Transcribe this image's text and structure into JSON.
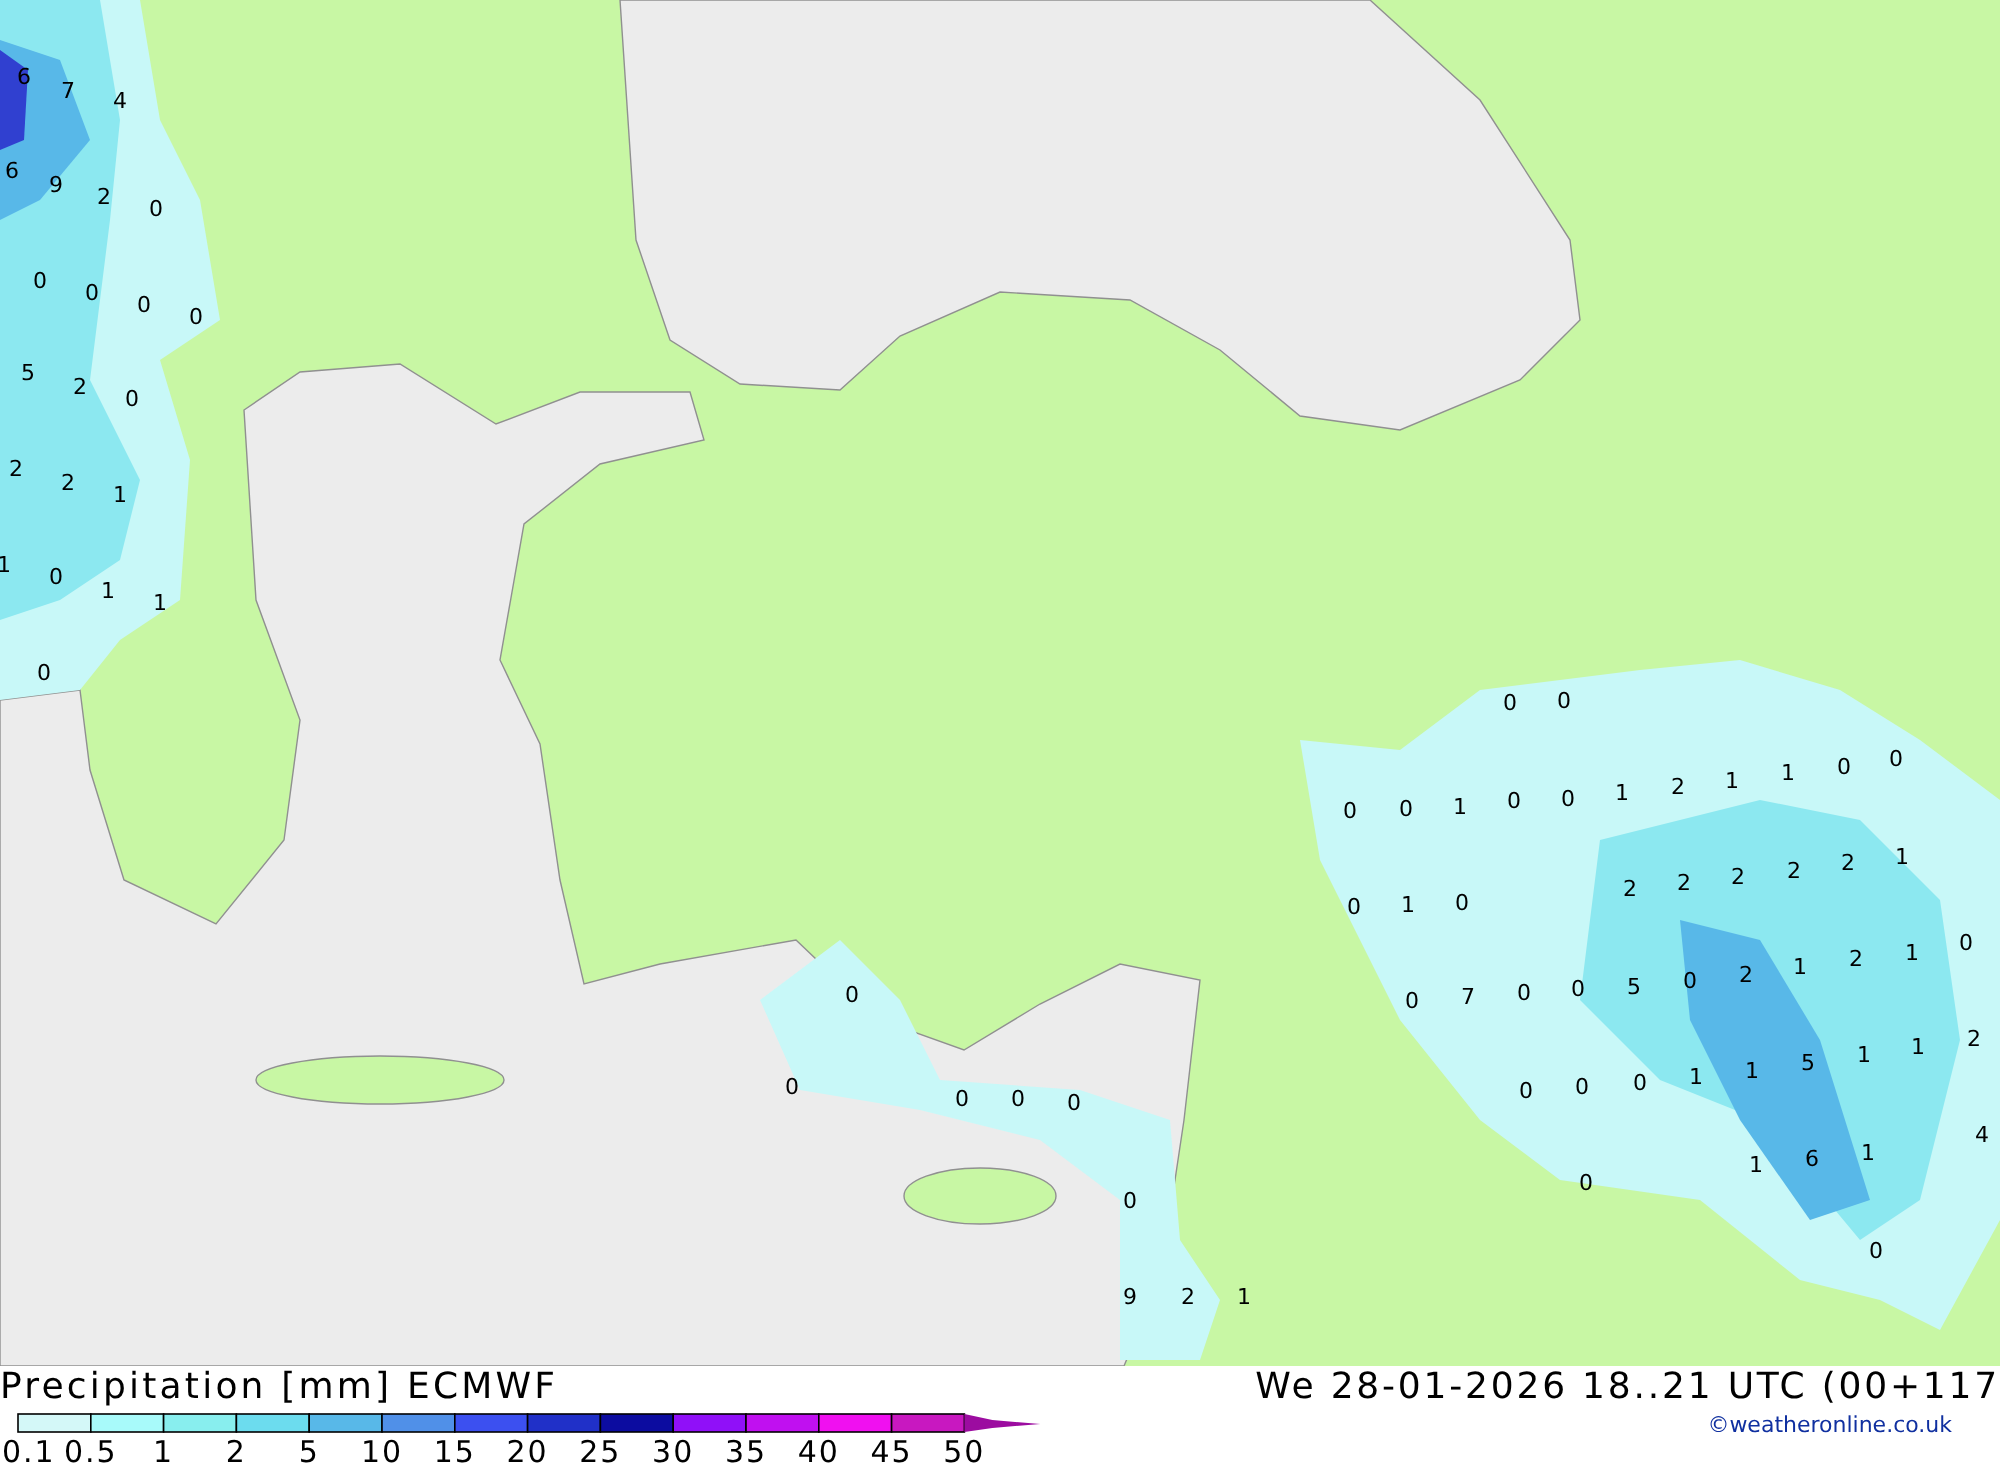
{
  "map": {
    "labels": [
      "6",
      "7",
      "4",
      "6",
      "9",
      "2",
      "0",
      "0",
      "0",
      "0",
      "0",
      "5",
      "2",
      "0",
      "2",
      "2",
      "1",
      "1",
      "0",
      "1",
      "1",
      "0",
      "0",
      "0",
      "0",
      "0",
      "1",
      "0",
      "0",
      "1",
      "2",
      "1",
      "1",
      "0",
      "0",
      "0",
      "1",
      "0",
      "2",
      "2",
      "2",
      "2",
      "2",
      "1",
      "0",
      "0",
      "7",
      "0",
      "0",
      "5",
      "0",
      "2",
      "1",
      "2",
      "1",
      "0",
      "0",
      "0",
      "0",
      "0",
      "0",
      "0",
      "0",
      "1",
      "1",
      "5",
      "1",
      "1",
      "2",
      "4",
      "1",
      "6",
      "1",
      "0",
      "0",
      "0",
      "9",
      "2",
      "1"
    ]
  },
  "title": "Precipitation [mm] ECMWF",
  "valid_time": "We 28-01-2026 18..21 UTC (00+117",
  "legend": {
    "swatches": [
      {
        "label": "0.1",
        "color": "#d4f8f8"
      },
      {
        "label": "0.5",
        "color": "#a8fafa"
      },
      {
        "label": "1",
        "color": "#88eeee"
      },
      {
        "label": "2",
        "color": "#6cdcee"
      },
      {
        "label": "5",
        "color": "#58b8e8"
      },
      {
        "label": "10",
        "color": "#5090e8"
      },
      {
        "label": "15",
        "color": "#3c50f0"
      },
      {
        "label": "20",
        "color": "#2030c8"
      },
      {
        "label": "25",
        "color": "#0c0ca0"
      },
      {
        "label": "30",
        "color": "#9010f8"
      },
      {
        "label": "35",
        "color": "#c010f0"
      },
      {
        "label": "40",
        "color": "#f010f0"
      },
      {
        "label": "45",
        "color": "#c818c0"
      },
      {
        "label": "50",
        "color": "#9c0ca0"
      }
    ]
  },
  "credit": "©weatheronline.co.uk"
}
